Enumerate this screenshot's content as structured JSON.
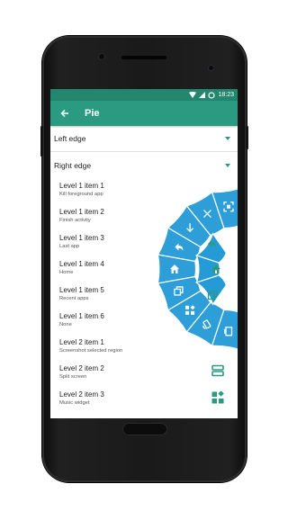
{
  "status": {
    "time": "18:23"
  },
  "appbar": {
    "title": "Pie"
  },
  "sections": {
    "left_edge": "Left edge",
    "right_edge": "Right edge"
  },
  "items": [
    {
      "title": "Level 1 item 1",
      "subtitle": "Kill foreground app"
    },
    {
      "title": "Level 1 item 2",
      "subtitle": "Finish activity"
    },
    {
      "title": "Level 1 item 3",
      "subtitle": "Last app"
    },
    {
      "title": "Level 1 item 4",
      "subtitle": "Home"
    },
    {
      "title": "Level 1 item 5",
      "subtitle": "Recent apps"
    },
    {
      "title": "Level 1 item 6",
      "subtitle": "None"
    },
    {
      "title": "Level 2 item 1",
      "subtitle": "Screenshot selected region"
    },
    {
      "title": "Level 2 item 2",
      "subtitle": "Split screen"
    },
    {
      "title": "Level 2 item 3",
      "subtitle": "Music widget"
    }
  ],
  "colors": {
    "accent": "#2a9a80",
    "status_bar": "#23876f",
    "pie": "#2d9ed8",
    "pie_inner": "#249bd6"
  },
  "pie": {
    "inner_icons": [
      "back-arrow-icon",
      "home-icon",
      "recents-icon"
    ],
    "outer_icons": [
      "screenshot-region-icon",
      "close-icon",
      "download-arrow-icon",
      "back-arrow-icon",
      "home-icon",
      "recents-icon",
      "widgets-icon",
      "rotate-icon",
      "split-screen-icon"
    ]
  }
}
